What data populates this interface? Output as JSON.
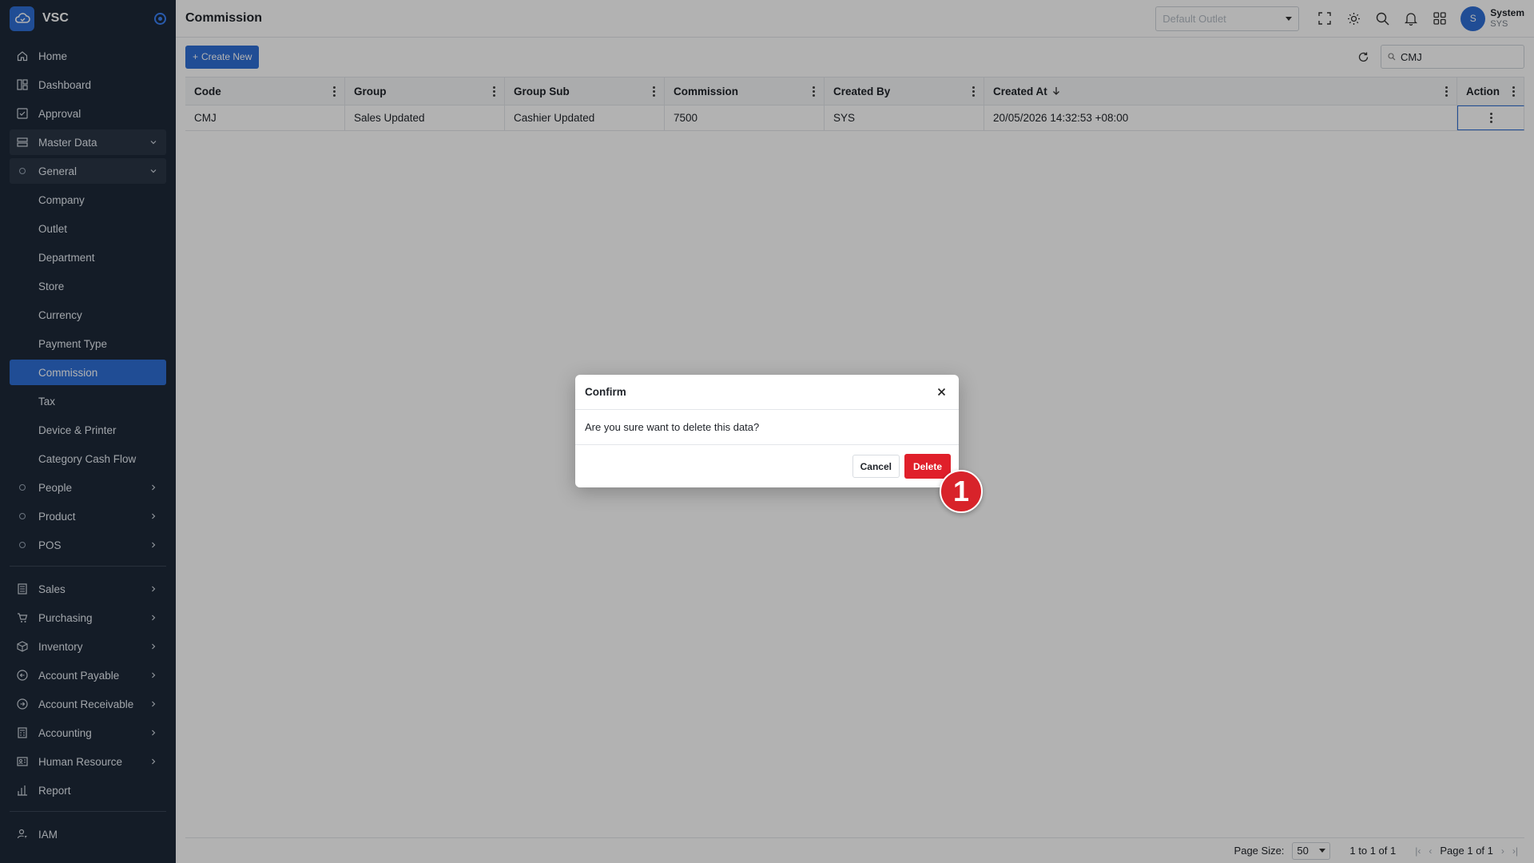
{
  "app": {
    "name": "VSC"
  },
  "sidebar": {
    "items": [
      {
        "label": "Home",
        "icon": "home-icon"
      },
      {
        "label": "Dashboard",
        "icon": "dashboard-icon"
      },
      {
        "label": "Approval",
        "icon": "approval-icon"
      },
      {
        "label": "Master Data",
        "icon": "master-data-icon"
      },
      {
        "label": "General",
        "icon": "circle-icon"
      },
      {
        "label": "Company"
      },
      {
        "label": "Outlet"
      },
      {
        "label": "Department"
      },
      {
        "label": "Store"
      },
      {
        "label": "Currency"
      },
      {
        "label": "Payment Type"
      },
      {
        "label": "Commission"
      },
      {
        "label": "Tax"
      },
      {
        "label": "Device & Printer"
      },
      {
        "label": "Category Cash Flow"
      },
      {
        "label": "People",
        "icon": "circle-icon"
      },
      {
        "label": "Product",
        "icon": "circle-icon"
      },
      {
        "label": "POS",
        "icon": "circle-icon"
      },
      {
        "label": "Sales",
        "icon": "sales-icon"
      },
      {
        "label": "Purchasing",
        "icon": "cart-icon"
      },
      {
        "label": "Inventory",
        "icon": "box-icon"
      },
      {
        "label": "Account Payable",
        "icon": "arrow-left-circle-icon"
      },
      {
        "label": "Account Receivable",
        "icon": "arrow-right-circle-icon"
      },
      {
        "label": "Accounting",
        "icon": "calculator-icon"
      },
      {
        "label": "Human Resource",
        "icon": "id-card-icon"
      },
      {
        "label": "Report",
        "icon": "bar-chart-icon"
      },
      {
        "label": "IAM",
        "icon": "user-key-icon"
      }
    ]
  },
  "header": {
    "title": "Commission",
    "outlet_placeholder": "Default Outlet",
    "user": {
      "initial": "S",
      "name": "System",
      "code": "SYS"
    }
  },
  "toolbar": {
    "create_label": "Create New",
    "search_value": "CMJ"
  },
  "table": {
    "columns": [
      "Code",
      "Group",
      "Group Sub",
      "Commission",
      "Created By",
      "Created At",
      "Action"
    ],
    "rows": [
      [
        "CMJ",
        "Sales Updated",
        "Cashier Updated",
        "7500",
        "SYS",
        "20/05/2026 14:32:53 +08:00"
      ]
    ]
  },
  "footer": {
    "page_size_label": "Page Size:",
    "page_size_value": "50",
    "range_text": "1 to 1 of 1",
    "page_text": "Page 1 of 1"
  },
  "modal": {
    "title": "Confirm",
    "message": "Are you sure want to delete this data?",
    "cancel_label": "Cancel",
    "delete_label": "Delete"
  },
  "annotation": {
    "step": "1"
  },
  "colors": {
    "accent": "#2f6fd6",
    "danger": "#e01f2a",
    "sidebar": "#1d2938"
  }
}
